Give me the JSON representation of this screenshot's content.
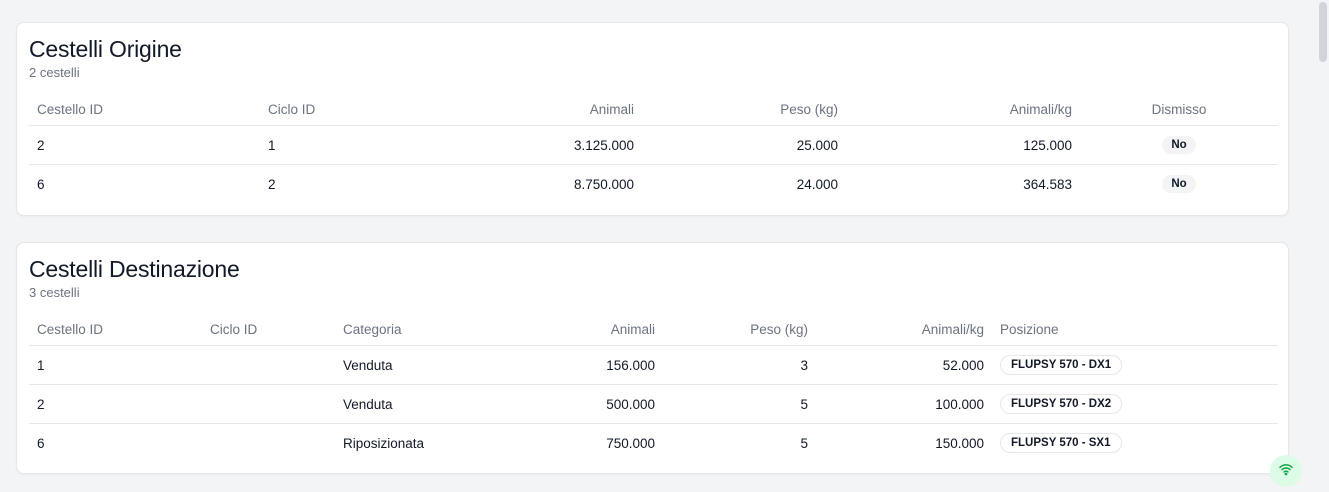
{
  "origine": {
    "title": "Cestelli Origine",
    "subtitle": "2 cestelli",
    "columns": [
      "Cestello ID",
      "Ciclo ID",
      "Animali",
      "Peso (kg)",
      "Animali/kg",
      "Dismisso"
    ],
    "rows": [
      {
        "cestello_id": "2",
        "ciclo_id": "1",
        "animali": "3.125.000",
        "peso": "25.000",
        "animali_kg": "125.000",
        "dismisso": "No"
      },
      {
        "cestello_id": "6",
        "ciclo_id": "2",
        "animali": "8.750.000",
        "peso": "24.000",
        "animali_kg": "364.583",
        "dismisso": "No"
      }
    ]
  },
  "destinazione": {
    "title": "Cestelli Destinazione",
    "subtitle": "3 cestelli",
    "columns": [
      "Cestello ID",
      "Ciclo ID",
      "Categoria",
      "Animali",
      "Peso (kg)",
      "Animali/kg",
      "Posizione"
    ],
    "rows": [
      {
        "cestello_id": "1",
        "ciclo_id": "",
        "categoria": "Venduta",
        "animali": "156.000",
        "peso": "3",
        "animali_kg": "52.000",
        "posizione": "FLUPSY 570 - DX1"
      },
      {
        "cestello_id": "2",
        "ciclo_id": "",
        "categoria": "Venduta",
        "animali": "500.000",
        "peso": "5",
        "animali_kg": "100.000",
        "posizione": "FLUPSY 570 - DX2"
      },
      {
        "cestello_id": "6",
        "ciclo_id": "",
        "categoria": "Riposizionata",
        "animali": "750.000",
        "peso": "5",
        "animali_kg": "150.000",
        "posizione": "FLUPSY 570 - SX1"
      }
    ]
  },
  "icons": {
    "connection_status": "wifi-icon"
  },
  "colors": {
    "background": "#f3f4f6",
    "card": "#ffffff",
    "muted_text": "#6b7280",
    "status_green": "#16a34a"
  }
}
